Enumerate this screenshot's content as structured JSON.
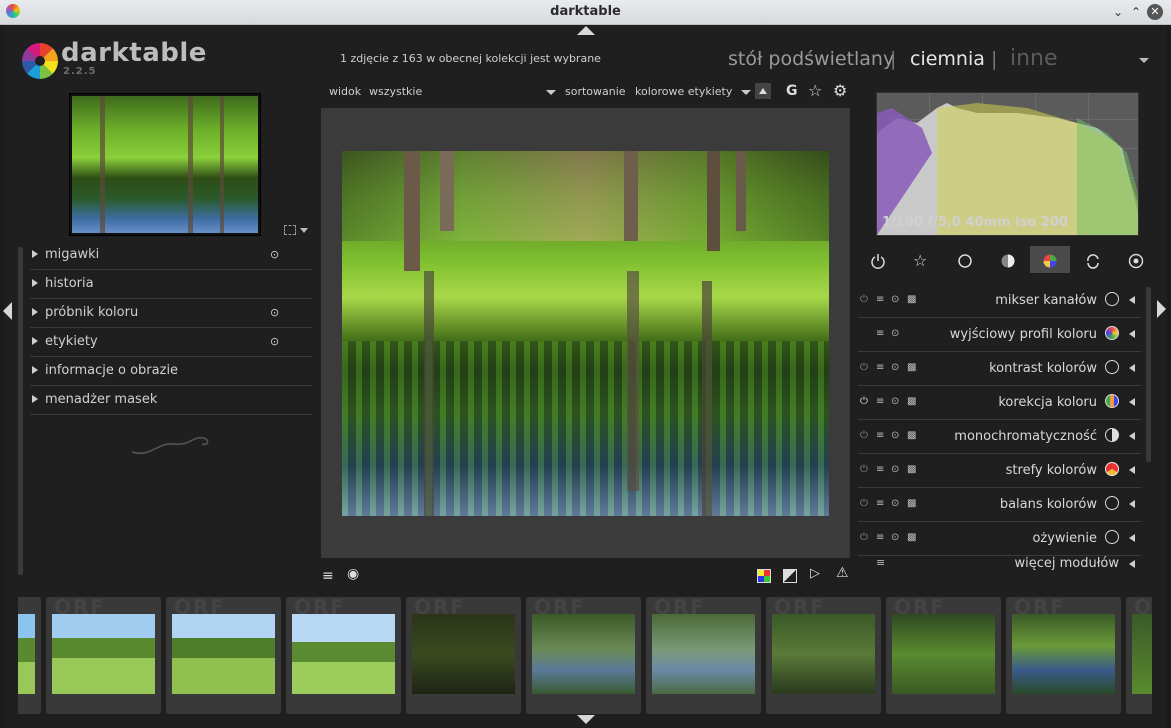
{
  "window": {
    "title": "darktable"
  },
  "app": {
    "name": "darktable",
    "version": "2.2.5"
  },
  "header": {
    "status": "1 zdjęcie z 163 w obecnej kolekcji jest wybrane",
    "views": {
      "lighttable": "stół podświetlany",
      "sep1": "|",
      "darkroom": "ciemnia",
      "sep2": "|",
      "other": "inne"
    },
    "active_view": "ciemnia"
  },
  "top_toolbar": {
    "view_label": "widok",
    "view_value": "wszystkie",
    "sort_label": "sortowanie",
    "sort_value": "kolorowe etykiety",
    "g_label": "G"
  },
  "left_panel": {
    "items": [
      {
        "label": "migawki",
        "reset": true
      },
      {
        "label": "historia",
        "reset": false
      },
      {
        "label": "próbnik koloru",
        "reset": true
      },
      {
        "label": "etykiety",
        "reset": true
      },
      {
        "label": "informacje o obrazie",
        "reset": false
      },
      {
        "label": "menadżer masek",
        "reset": false
      }
    ]
  },
  "histogram": {
    "exif": "1/100 f/5,0 40mm iso 200"
  },
  "module_groups": [
    "power-icon",
    "star-icon",
    "circle-icon",
    "half-circle-icon",
    "color-icon",
    "correct-icon",
    "effect-icon"
  ],
  "modules": [
    {
      "label": "mikser kanałów",
      "icon": "mixer-icon"
    },
    {
      "label": "wyjściowy profil koloru",
      "icon": "output-profile-icon"
    },
    {
      "label": "kontrast kolorów",
      "icon": "circle-icon"
    },
    {
      "label": "korekcja koloru",
      "icon": "color-correction-icon"
    },
    {
      "label": "monochromatyczność",
      "icon": "half-circle-icon"
    },
    {
      "label": "strefy kolorów",
      "icon": "color-zones-icon"
    },
    {
      "label": "balans kolorów",
      "icon": "circle-icon"
    },
    {
      "label": "ożywienie",
      "icon": "circle-icon"
    }
  ],
  "more_modules": "więcej modułów",
  "filmstrip": {
    "ghost_text": "ORF"
  },
  "colors": {
    "accent": "#e0e0e0",
    "bg": "#1f1f1f",
    "panel": "#2a2a2a"
  }
}
